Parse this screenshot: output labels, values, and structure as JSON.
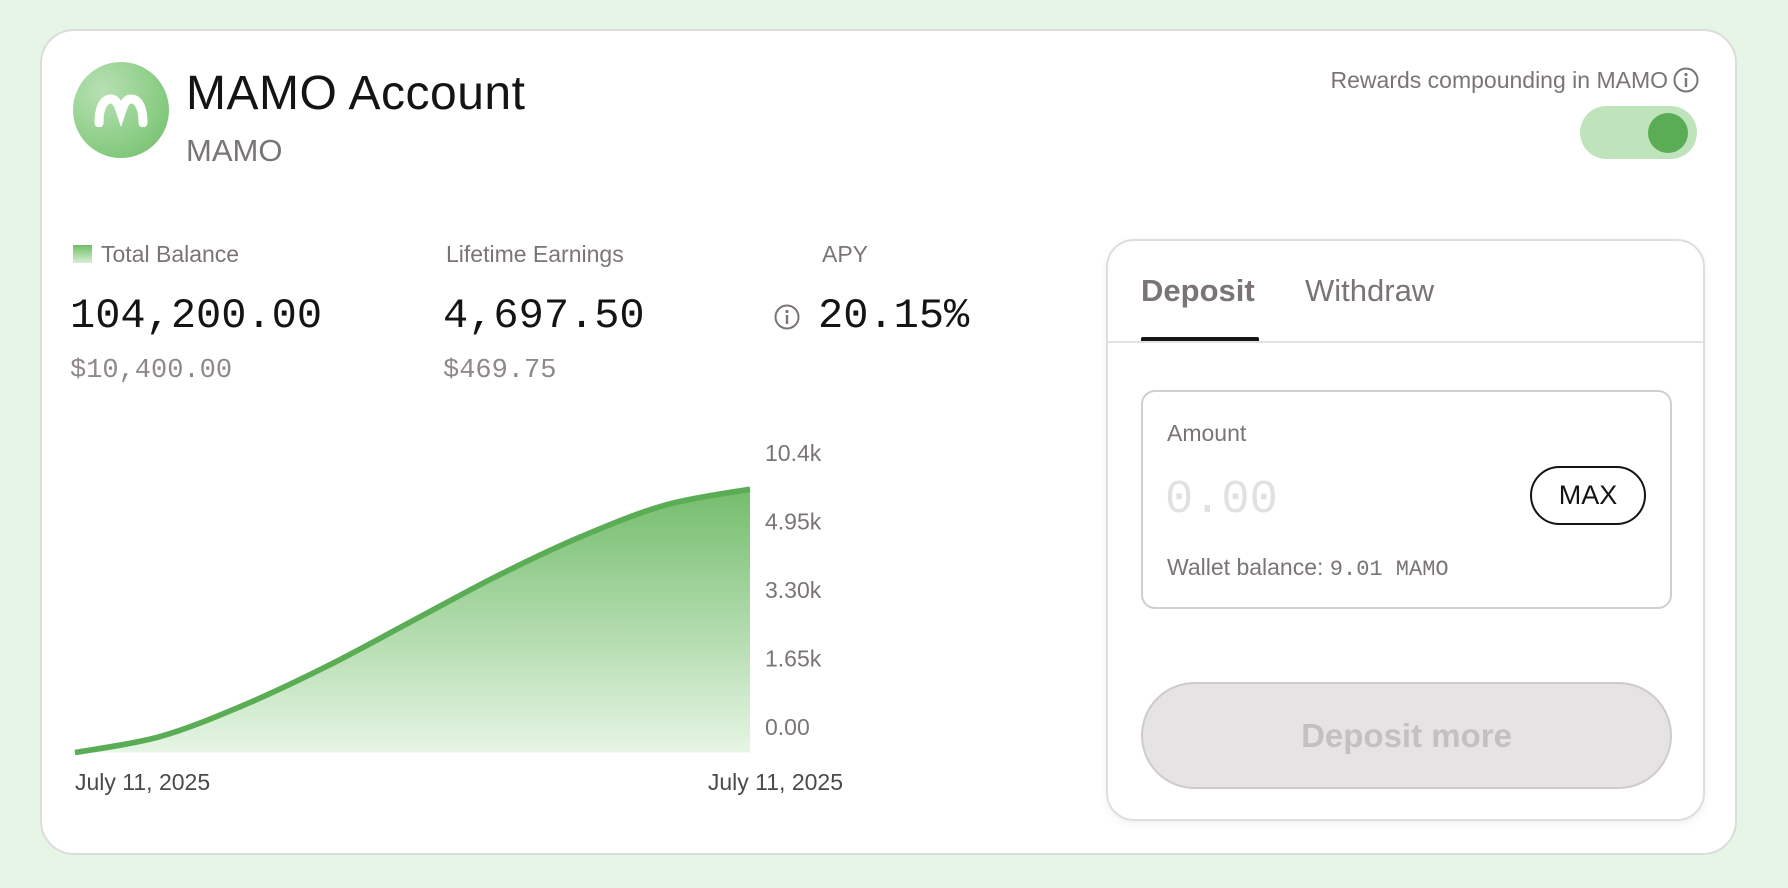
{
  "account": {
    "title": "MAMO Account",
    "symbol": "MAMO",
    "logo_icon": "mamo-logo-icon"
  },
  "rewards": {
    "label": "Rewards compounding in MAMO",
    "toggle_on": true,
    "accent": "#5aad55"
  },
  "stats": {
    "total_balance": {
      "label": "Total Balance",
      "value": "104,200.00",
      "usd": "$10,400.00"
    },
    "lifetime_earnings": {
      "label": "Lifetime Earnings",
      "value": "4,697.50",
      "usd": "$469.75"
    },
    "apy": {
      "label": "APY",
      "value": "20.15%"
    }
  },
  "chart_data": {
    "type": "area",
    "x_labels": [
      "July 11, 2025",
      "July 11, 2025"
    ],
    "y_ticks": [
      "0.00",
      "1.65k",
      "3.30k",
      "4.95k",
      "10.4k"
    ],
    "y_tick_values": [
      0,
      1650,
      3300,
      4950,
      10400
    ],
    "y_tick_positions_index": [
      0,
      1,
      2,
      3,
      4
    ],
    "series": [
      {
        "values": [
          0,
          0.06,
          0.18,
          0.33,
          0.5,
          0.67,
          0.82,
          0.94,
          1.0
        ]
      }
    ],
    "value_scale_note": "",
    "color": "#5aad55",
    "grid": false
  },
  "panel": {
    "tabs": [
      {
        "label": "Deposit",
        "active": true
      },
      {
        "label": "Withdraw",
        "active": false
      }
    ],
    "amount_label": "Amount",
    "amount_placeholder": "0.00",
    "amount_value": "",
    "max_label": "MAX",
    "wallet_balance_label": "Wallet balance:",
    "wallet_balance_value": "9.01 MAMO",
    "submit_label": "Deposit more"
  }
}
